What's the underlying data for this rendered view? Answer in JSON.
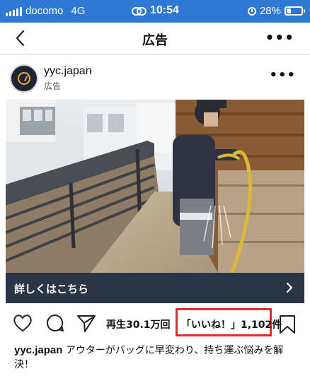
{
  "status_bar": {
    "carrier": "docomo",
    "network": "4G",
    "time": "10:54",
    "battery": "28%"
  },
  "nav": {
    "title": "広告",
    "more": "•••"
  },
  "post": {
    "username": "yyc.japan",
    "sponsored_label": "広告",
    "more": "•••"
  },
  "cta": {
    "label": "詳しくはこちら"
  },
  "actions": {
    "views": "再生30.1万回",
    "likes": "「いいね！」1,102件",
    "highlight_color": "#e5292a"
  },
  "caption": {
    "username": "yyc.japan",
    "text": "アウターがバッグに早変わり、持ち運ぶ悩みを解決！"
  },
  "icons": [
    "signal-icon",
    "link-icon",
    "alarm-icon",
    "battery-icon",
    "back-icon",
    "heart-icon",
    "comment-icon",
    "share-icon",
    "bookmark-icon",
    "chevron-right-icon"
  ],
  "colors": {
    "status_bar": "#2d78d3",
    "cta_bar": "#2a3545"
  }
}
